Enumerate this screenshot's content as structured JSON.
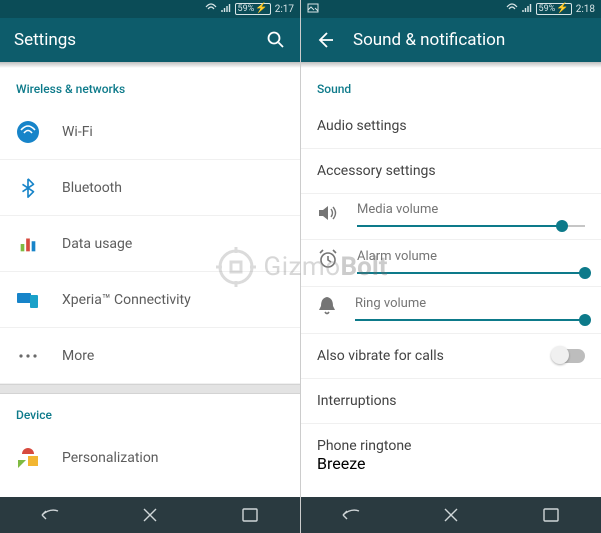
{
  "left": {
    "status": {
      "battery": "59%",
      "time": "2:17"
    },
    "appbar": {
      "title": "Settings"
    },
    "section1": "Wireless & networks",
    "items": [
      {
        "label": "Wi-Fi"
      },
      {
        "label": "Bluetooth"
      },
      {
        "label": "Data usage"
      },
      {
        "label": "Xperia™ Connectivity"
      },
      {
        "label": "More"
      }
    ],
    "section2": "Device",
    "items2": [
      {
        "label": "Personalization"
      }
    ]
  },
  "right": {
    "status": {
      "battery": "59%",
      "time": "2:18"
    },
    "appbar": {
      "title": "Sound & notification"
    },
    "section1": "Sound",
    "rows": {
      "audio": "Audio settings",
      "accessory": "Accessory settings"
    },
    "sliders": [
      {
        "label": "Media volume",
        "pct": 90
      },
      {
        "label": "Alarm volume",
        "pct": 100
      },
      {
        "label": "Ring volume",
        "pct": 100
      }
    ],
    "vibrate": {
      "label": "Also vibrate for calls",
      "on": false
    },
    "interruptions": "Interruptions",
    "ringtone": {
      "label": "Phone ringtone",
      "value": "Breeze"
    }
  },
  "watermark": {
    "a": "Gizmo",
    "b": "Bolt"
  }
}
